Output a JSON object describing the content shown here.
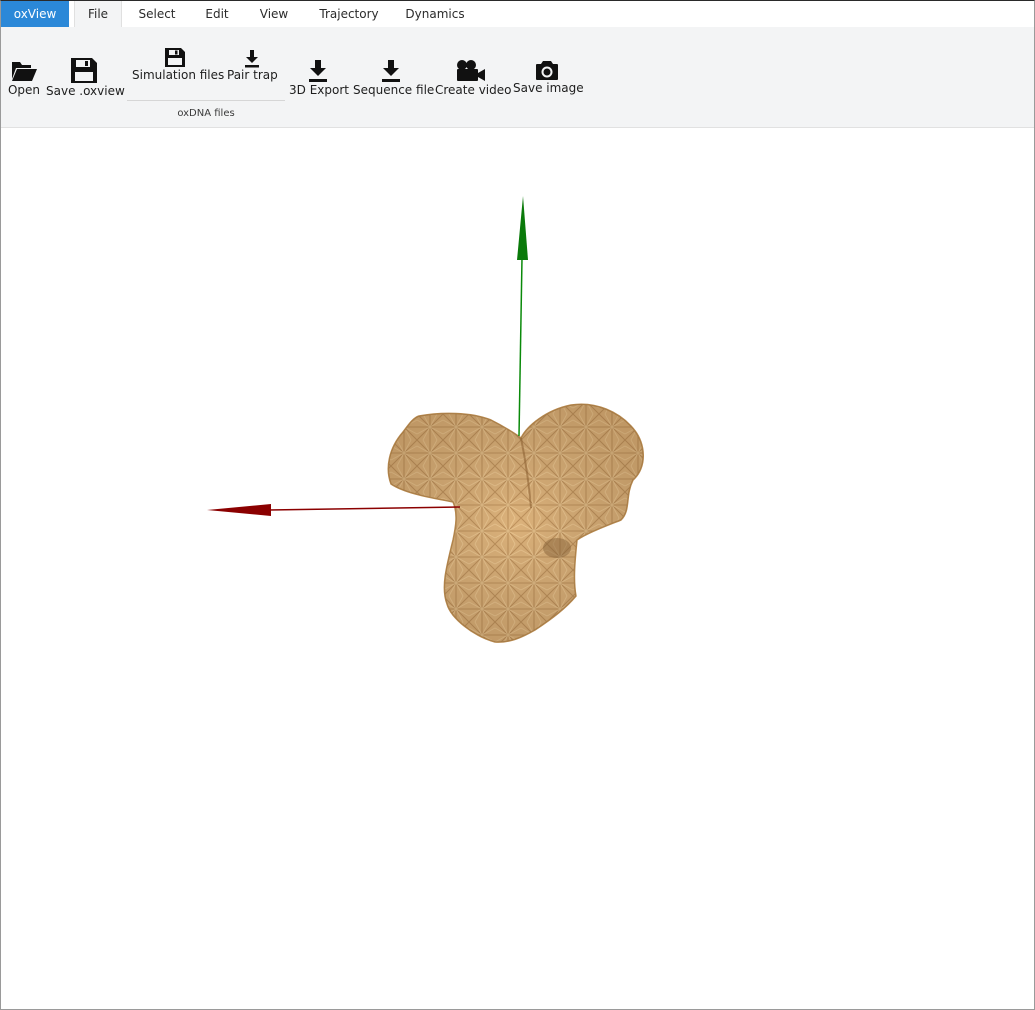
{
  "tabs": {
    "brand": "oxView",
    "items": [
      "File",
      "Select",
      "Edit",
      "View",
      "Trajectory",
      "Dynamics"
    ],
    "active": "File"
  },
  "ribbon": {
    "open": {
      "label": "Open",
      "icon": "folder-open-icon"
    },
    "save_oxview": {
      "label": "Save .oxview",
      "icon": "floppy-disk-icon"
    },
    "simulation_files": {
      "label": "Simulation files",
      "icon": "floppy-disk-icon"
    },
    "pair_trap": {
      "label": "Pair trap",
      "icon": "download-icon"
    },
    "group_label": "oxDNA files",
    "export_3d": {
      "label": "3D Export",
      "icon": "download-icon"
    },
    "sequence_file": {
      "label": "Sequence file",
      "icon": "download-icon"
    },
    "create_video": {
      "label": "Create video",
      "icon": "video-camera-icon"
    },
    "save_image": {
      "label": "Save image",
      "icon": "camera-icon"
    }
  },
  "colors": {
    "brand_tab": "#2b88d8",
    "ribbon_bg": "#f3f4f5",
    "structure": "#d9b07a",
    "axis_x": "#8b0000",
    "axis_y": "#008000"
  }
}
